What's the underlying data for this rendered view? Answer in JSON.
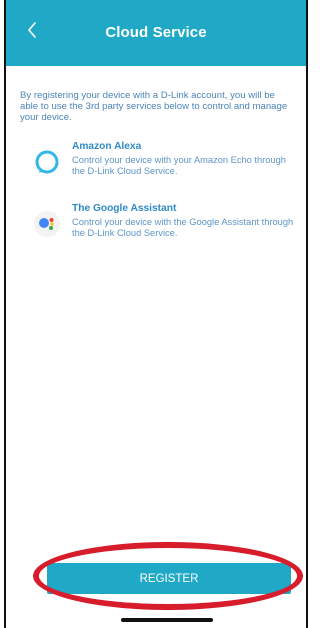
{
  "header": {
    "title": "Cloud Service",
    "back_icon": "chevron-left-icon"
  },
  "intro_text": "By registering your device with a D-Link account, you will be able to use the 3rd party services below to control and manage your device.",
  "services": [
    {
      "name": "Amazon Alexa",
      "description": "Control your device with your Amazon Echo through the D-Link Cloud Service.",
      "icon": "alexa-icon"
    },
    {
      "name": "The Google Assistant",
      "description": "Control your device with the Google Assistant through the D-Link Cloud Service.",
      "icon": "google-assistant-icon"
    }
  ],
  "register": {
    "label": "REGISTER"
  },
  "colors": {
    "accent": "#1fa9c6",
    "highlight_circle": "#d71d2c"
  }
}
